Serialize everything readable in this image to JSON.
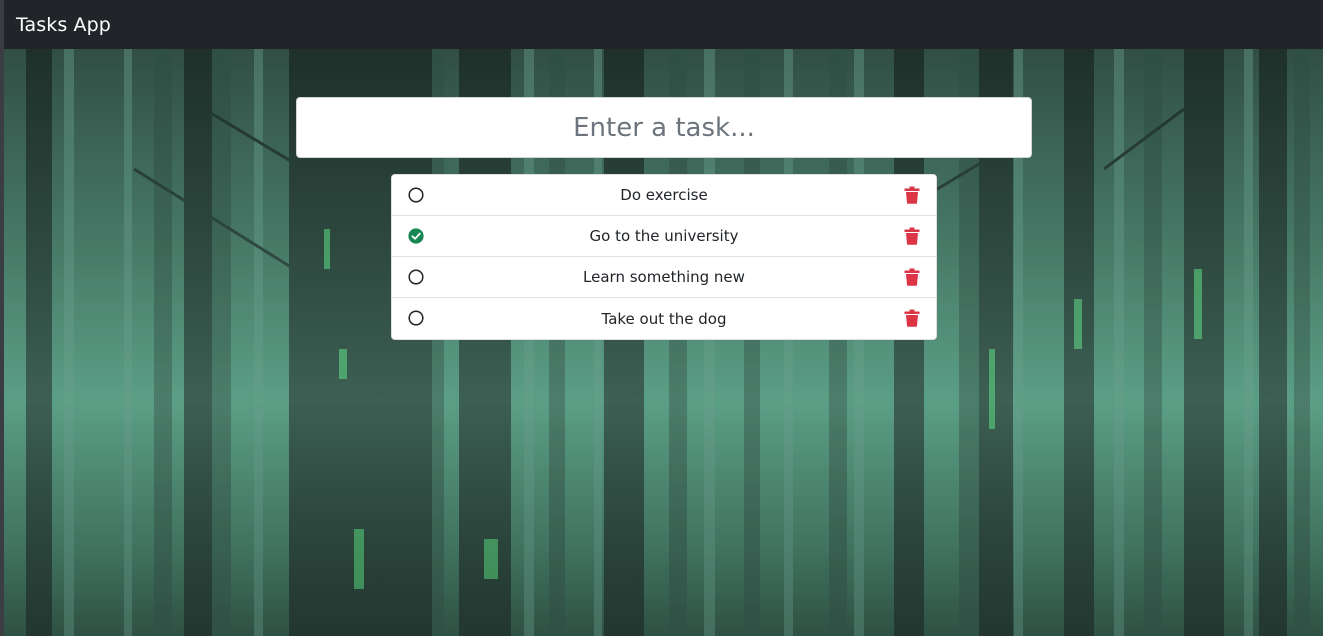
{
  "app": {
    "brand": "Tasks App"
  },
  "task_input": {
    "placeholder": "Enter a task...",
    "value": ""
  },
  "tasks": [
    {
      "text": "Do exercise",
      "done": false
    },
    {
      "text": "Go to the university",
      "done": true
    },
    {
      "text": "Learn something new",
      "done": false
    },
    {
      "text": "Take out the dog",
      "done": false
    }
  ],
  "icons": {
    "unchecked": "circle-icon",
    "checked": "check-circle-icon",
    "delete": "trash-icon"
  },
  "colors": {
    "navbar": "#212529",
    "check_done": "#198754",
    "delete": "#dc3545",
    "background_forest": "#3e6a5a"
  }
}
